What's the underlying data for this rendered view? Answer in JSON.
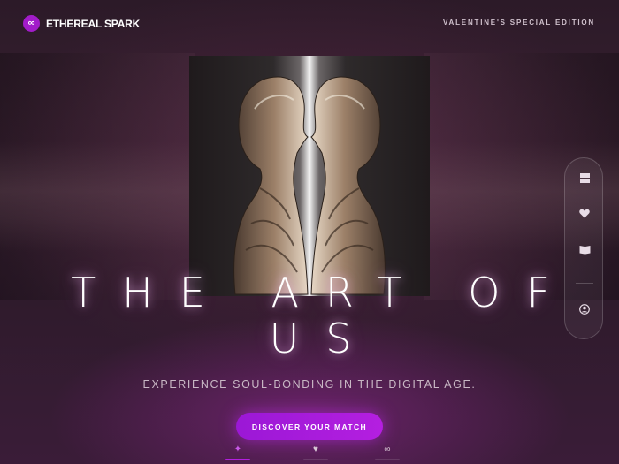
{
  "header": {
    "brand_logo": "∞",
    "brand_name": "ETHEREAL SPARK",
    "edition": "VALENTINE'S SPECIAL EDITION"
  },
  "hero": {
    "title_line1": "THE ART OF",
    "title_line2": "US",
    "subtitle": "EXPERIENCE SOUL-BONDING IN THE DIGITAL AGE.",
    "cta_label": "DISCOVER YOUR MATCH"
  },
  "bottom_tabs": [
    {
      "icon": "sparkles-icon",
      "glyph": "✦",
      "active": true
    },
    {
      "icon": "heart-icon",
      "glyph": "♥",
      "active": false
    },
    {
      "icon": "infinity-icon",
      "glyph": "∞",
      "active": false
    }
  ],
  "rail": [
    {
      "icon": "grid-icon"
    },
    {
      "icon": "heart-icon"
    },
    {
      "icon": "book-icon"
    },
    {
      "icon": "profile-icon"
    }
  ],
  "colors": {
    "accent": "#a21cc9",
    "cta": "#9b18d6",
    "background": "#2c1a28"
  }
}
